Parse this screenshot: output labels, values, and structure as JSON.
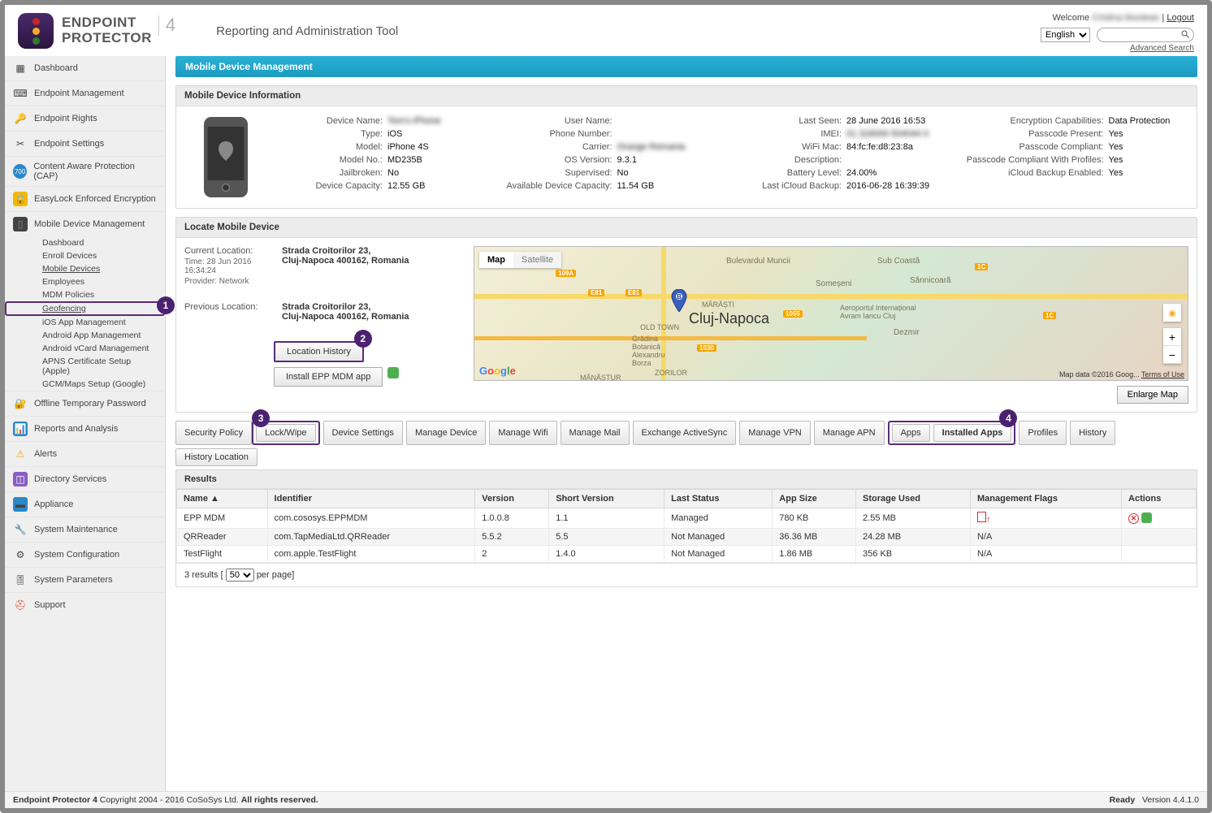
{
  "brand": {
    "title": "ENDPOINT",
    "sub": "PROTECTOR",
    "four": "4",
    "tagline": "Reporting and Administration Tool"
  },
  "top": {
    "welcome": "Welcome",
    "username": "Cristina Muntean",
    "logout": "Logout",
    "language": "English",
    "advanced_search": "Advanced Search",
    "search_placeholder": ""
  },
  "nav": {
    "dashboard": "Dashboard",
    "endpoint_mgmt": "Endpoint Management",
    "endpoint_rights": "Endpoint Rights",
    "endpoint_settings": "Endpoint Settings",
    "cap": "Content Aware Protection (CAP)",
    "easylock": "EasyLock Enforced Encryption",
    "mdm": "Mobile Device Management",
    "mdm_sub": {
      "dashboard": "Dashboard",
      "enroll": "Enroll Devices",
      "mobile_devices": "Mobile Devices",
      "employees": "Employees",
      "mdm_policies": "MDM Policies",
      "geofencing": "Geofencing",
      "ios_app": "iOS App Management",
      "android_app": "Android App Management",
      "android_vcard": "Android vCard Management",
      "apns": "APNS Certificate Setup (Apple)",
      "gcm": "GCM/Maps Setup (Google)"
    },
    "offline_temp_pw": "Offline Temporary Password",
    "reports": "Reports and Analysis",
    "alerts": "Alerts",
    "directory": "Directory Services",
    "appliance": "Appliance",
    "sys_maint": "System Maintenance",
    "sys_config": "System Configuration",
    "sys_params": "System Parameters",
    "support": "Support"
  },
  "steps": {
    "one": "1",
    "two": "2",
    "three": "3",
    "four": "4"
  },
  "page": {
    "title": "Mobile Device Management"
  },
  "device_info": {
    "header": "Mobile Device Information",
    "labels": {
      "device_name": "Device Name:",
      "type": "Type:",
      "model": "Model:",
      "model_no": "Model No.:",
      "jailbroken": "Jailbroken:",
      "capacity": "Device Capacity:",
      "user_name": "User Name:",
      "phone": "Phone Number:",
      "carrier": "Carrier:",
      "os_version": "OS Version:",
      "supervised": "Supervised:",
      "avail_capacity": "Available Device Capacity:",
      "last_seen": "Last Seen:",
      "imei": "IMEI:",
      "wifi_mac": "WiFi Mac:",
      "description": "Description:",
      "battery": "Battery Level:",
      "last_icloud": "Last iCloud Backup:",
      "enc_cap": "Encryption Capabilities:",
      "pc_present": "Passcode Present:",
      "pc_compliant": "Passcode Compliant:",
      "pc_profiles": "Passcode Compliant With Profiles:",
      "icloud_enabled": "iCloud Backup Enabled:"
    },
    "values": {
      "device_name": "Tom's iPhone",
      "type": "iOS",
      "model": "iPhone 4S",
      "model_no": "MD235B",
      "jailbroken": "No",
      "capacity": "12.55 GB",
      "user_name": "",
      "phone": "",
      "carrier": "Orange Romania",
      "os_version": "9.3.1",
      "supervised": "No",
      "avail_capacity": "11.54 GB",
      "last_seen": "28 June 2016 16:53",
      "imei": "01 316000 504044 0",
      "wifi_mac": "84:fc:fe:d8:23:8a",
      "description": "",
      "battery": "24.00%",
      "last_icloud": "2016-06-28 16:39:39",
      "enc_cap": "Data Protection",
      "pc_present": "Yes",
      "pc_compliant": "Yes",
      "pc_profiles": "Yes",
      "icloud_enabled": "Yes"
    }
  },
  "locate": {
    "header": "Locate Mobile Device",
    "current_label": "Current Location:",
    "current_meta1": "Time: 28 Jun 2016 16:34:24",
    "current_meta2": "Provider: Network",
    "address1": "Strada Croitorilor 23,",
    "address2": "Cluj-Napoca 400162, Romania",
    "previous_label": "Previous Location:",
    "prev_address1": "Strada Croitorilor 23,",
    "prev_address2": "Cluj-Napoca 400162, Romania",
    "btn_history": "Location History",
    "btn_install": "Install EPP MDM app",
    "map_tab_map": "Map",
    "map_tab_sat": "Satellite",
    "map_city": "Cluj-Napoca",
    "map_google": "Google",
    "map_attrib": "Map data ©2016 Goog...",
    "map_terms": "Terms of Use",
    "enlarge": "Enlarge Map",
    "map_labels": {
      "bulevardul": "Bulevardul Muncii",
      "subcoasta": "Sub Coastă",
      "sannicoara": "Sânnicoară",
      "somes": "Someșeni",
      "marasti": "MĂRĂȘTI",
      "oldtown": "OLD TOWN",
      "gradina": "Grădina\nBotanică\nAlexandru\nBorza",
      "zorilor": "ZORILOR",
      "aeroport": "Aeroportul Internațional\nAvram Iancu Cluj",
      "dezmir": "Dezmir",
      "manastur": "MĂNĂȘTUR"
    }
  },
  "tabs": {
    "security_policy": "Security Policy",
    "lock_wipe": "Lock/Wipe",
    "device_settings": "Device Settings",
    "manage_device": "Manage Device",
    "manage_wifi": "Manage Wifi",
    "manage_mail": "Manage Mail",
    "exchange": "Exchange ActiveSync",
    "manage_vpn": "Manage VPN",
    "manage_apn": "Manage APN",
    "apps": "Apps",
    "installed_apps": "Installed Apps",
    "profiles": "Profiles",
    "history": "History",
    "history_loc": "History Location"
  },
  "results": {
    "header": "Results",
    "columns": {
      "name": "Name ▲",
      "identifier": "Identifier",
      "version": "Version",
      "short_version": "Short Version",
      "last_status": "Last Status",
      "app_size": "App Size",
      "storage_used": "Storage Used",
      "mgmt_flags": "Management Flags",
      "actions": "Actions"
    },
    "rows": [
      {
        "name": "EPP MDM",
        "identifier": "com.cososys.EPPMDM",
        "version": "1.0.0.8",
        "short_version": "1.1",
        "last_status": "Managed",
        "app_size": "780 KB",
        "storage_used": "2.55 MB",
        "mgmt_flags": "flags",
        "actions": "actions"
      },
      {
        "name": "QRReader",
        "identifier": "com.TapMediaLtd.QRReader",
        "version": "5.5.2",
        "short_version": "5.5",
        "last_status": "Not Managed",
        "app_size": "36.36 MB",
        "storage_used": "24.28 MB",
        "mgmt_flags": "N/A",
        "actions": ""
      },
      {
        "name": "TestFlight",
        "identifier": "com.apple.TestFlight",
        "version": "2",
        "short_version": "1.4.0",
        "last_status": "Not Managed",
        "app_size": "1.86 MB",
        "storage_used": "356 KB",
        "mgmt_flags": "N/A",
        "actions": ""
      }
    ],
    "pager_prefix": "3 results  [",
    "pager_suffix": "  per page]",
    "pager_size": "50"
  },
  "footer": {
    "copy": "Endpoint Protector 4 Copyright 2004 - 2016 CoSoSys Ltd. All rights reserved.",
    "ready": "Ready",
    "version": "Version 4.4.1.0"
  }
}
